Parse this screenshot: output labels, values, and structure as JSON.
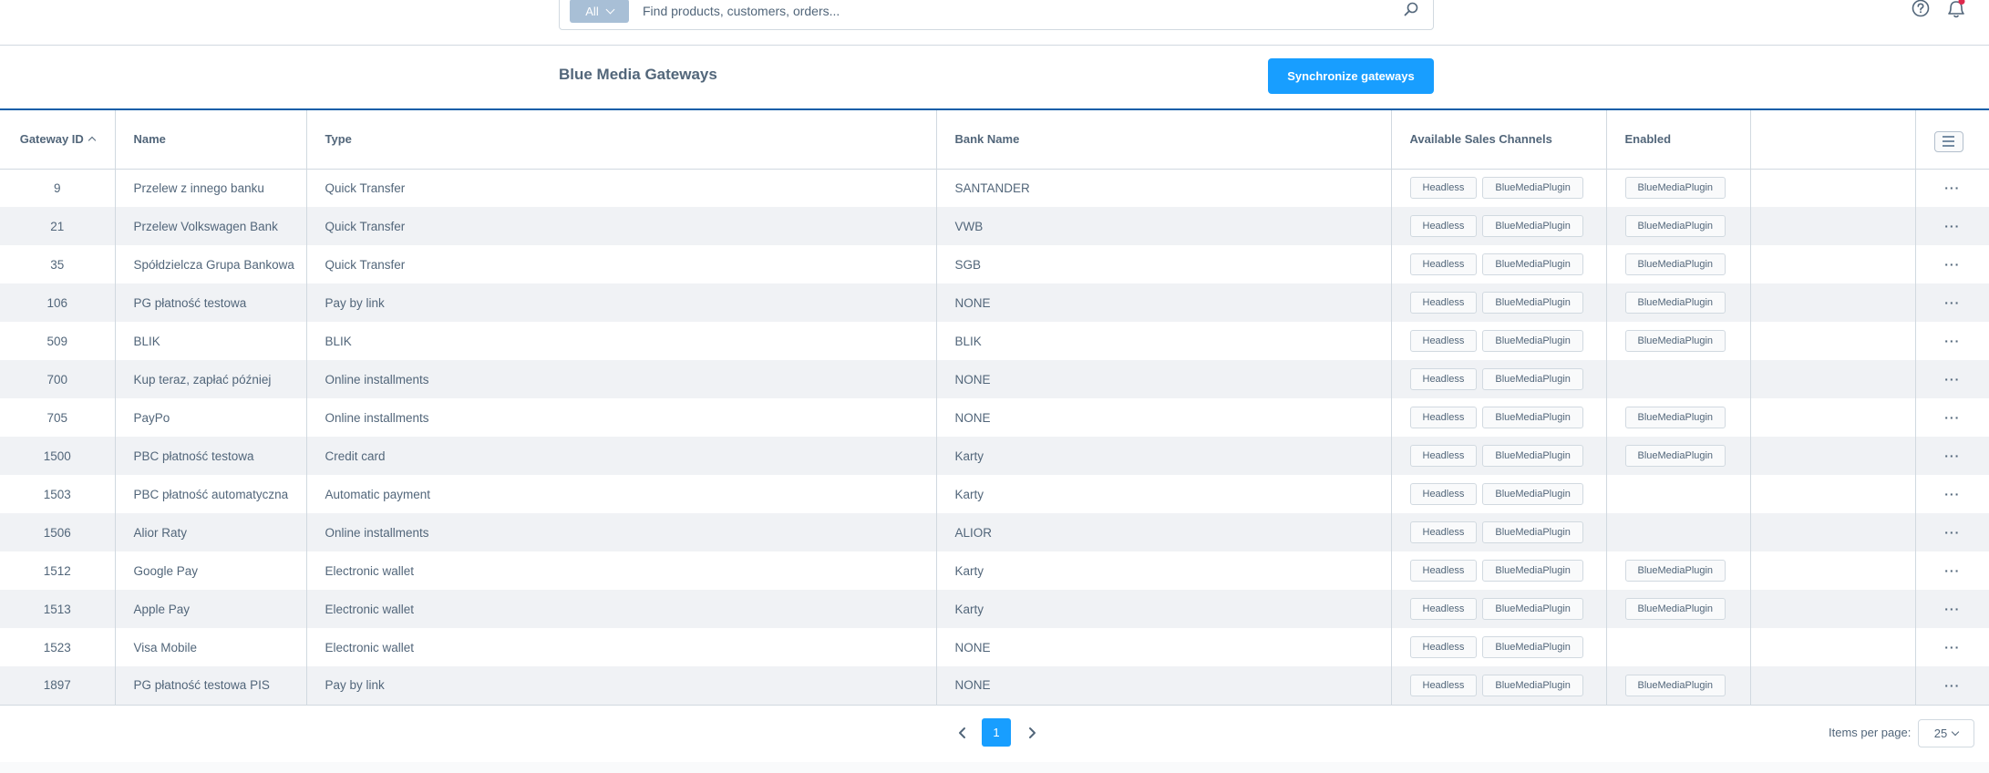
{
  "topbar": {
    "search_type": "All",
    "search_placeholder": "Find products, customers, orders...",
    "icons": [
      "search-icon",
      "help-icon",
      "bell-icon"
    ],
    "notification_dot_color": "#de294c"
  },
  "card": {
    "title": "Blue Media Gateways",
    "sync_button": "Synchronize gateways",
    "accent_color": "#189eff"
  },
  "table": {
    "columns": [
      "Gateway ID",
      "Name",
      "Type",
      "Bank Name",
      "Available Sales Channels",
      "Enabled",
      ""
    ],
    "sort": {
      "column": "Gateway ID",
      "direction": "ascending"
    },
    "rows": [
      {
        "id": "9",
        "name": "Przelew z innego banku",
        "type": "Quick Transfer",
        "bank": "SANTANDER",
        "channels": [
          "Headless",
          "BlueMediaPlugin"
        ],
        "enabled": [
          "BlueMediaPlugin"
        ]
      },
      {
        "id": "21",
        "name": "Przelew Volkswagen Bank",
        "type": "Quick Transfer",
        "bank": "VWB",
        "channels": [
          "Headless",
          "BlueMediaPlugin"
        ],
        "enabled": [
          "BlueMediaPlugin"
        ]
      },
      {
        "id": "35",
        "name": "Spółdzielcza Grupa Bankowa",
        "type": "Quick Transfer",
        "bank": "SGB",
        "channels": [
          "Headless",
          "BlueMediaPlugin"
        ],
        "enabled": [
          "BlueMediaPlugin"
        ]
      },
      {
        "id": "106",
        "name": "PG płatność testowa",
        "type": "Pay by link",
        "bank": "NONE",
        "channels": [
          "Headless",
          "BlueMediaPlugin"
        ],
        "enabled": [
          "BlueMediaPlugin"
        ]
      },
      {
        "id": "509",
        "name": "BLIK",
        "type": "BLIK",
        "bank": "BLIK",
        "channels": [
          "Headless",
          "BlueMediaPlugin"
        ],
        "enabled": [
          "BlueMediaPlugin"
        ]
      },
      {
        "id": "700",
        "name": "Kup teraz, zapłać później",
        "type": "Online installments",
        "bank": "NONE",
        "channels": [
          "Headless",
          "BlueMediaPlugin"
        ],
        "enabled": []
      },
      {
        "id": "705",
        "name": "PayPo",
        "type": "Online installments",
        "bank": "NONE",
        "channels": [
          "Headless",
          "BlueMediaPlugin"
        ],
        "enabled": [
          "BlueMediaPlugin"
        ]
      },
      {
        "id": "1500",
        "name": "PBC płatność testowa",
        "type": "Credit card",
        "bank": "Karty",
        "channels": [
          "Headless",
          "BlueMediaPlugin"
        ],
        "enabled": [
          "BlueMediaPlugin"
        ]
      },
      {
        "id": "1503",
        "name": "PBC płatność automatyczna",
        "type": "Automatic payment",
        "bank": "Karty",
        "channels": [
          "Headless",
          "BlueMediaPlugin"
        ],
        "enabled": []
      },
      {
        "id": "1506",
        "name": "Alior Raty",
        "type": "Online installments",
        "bank": "ALIOR",
        "channels": [
          "Headless",
          "BlueMediaPlugin"
        ],
        "enabled": []
      },
      {
        "id": "1512",
        "name": "Google Pay",
        "type": "Electronic wallet",
        "bank": "Karty",
        "channels": [
          "Headless",
          "BlueMediaPlugin"
        ],
        "enabled": [
          "BlueMediaPlugin"
        ]
      },
      {
        "id": "1513",
        "name": "Apple Pay",
        "type": "Electronic wallet",
        "bank": "Karty",
        "channels": [
          "Headless",
          "BlueMediaPlugin"
        ],
        "enabled": [
          "BlueMediaPlugin"
        ]
      },
      {
        "id": "1523",
        "name": "Visa Mobile",
        "type": "Electronic wallet",
        "bank": "NONE",
        "channels": [
          "Headless",
          "BlueMediaPlugin"
        ],
        "enabled": []
      },
      {
        "id": "1897",
        "name": "PG płatność testowa PIS",
        "type": "Pay by link",
        "bank": "NONE",
        "channels": [
          "Headless",
          "BlueMediaPlugin"
        ],
        "enabled": [
          "BlueMediaPlugin"
        ]
      }
    ],
    "row_action_label": "···"
  },
  "pagination": {
    "current_page": "1",
    "items_per_page_label": "Items per page:",
    "items_per_page": "25"
  }
}
